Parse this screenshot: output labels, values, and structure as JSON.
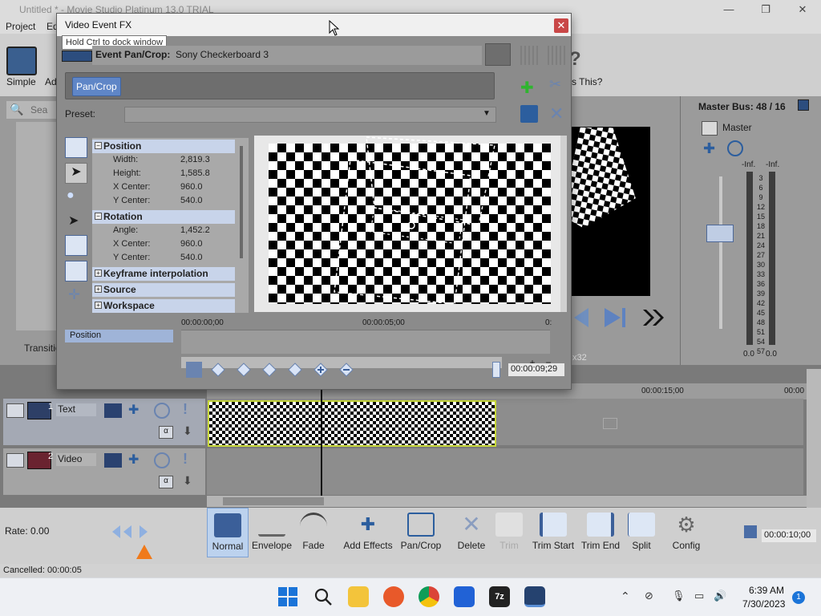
{
  "app": {
    "title": "Untitled * - Movie Studio Platinum 13.0 TRIAL",
    "menu": [
      "Project",
      "Ed"
    ]
  },
  "toolbar": {
    "simple_label": "Simple",
    "advanced_label": "Ad",
    "help_label": "s This?"
  },
  "left_panel": {
    "search_placeholder": "Sea",
    "transitions_tab": "Transitio"
  },
  "master_bus": {
    "title": "Master Bus: 48 / 16",
    "master_label": "Master",
    "peak_left": "-Inf.",
    "peak_right": "-Inf.",
    "scale": [
      "3",
      "6",
      "9",
      "12",
      "15",
      "18",
      "21",
      "24",
      "27",
      "30",
      "33",
      "36",
      "39",
      "42",
      "45",
      "48",
      "51",
      "54",
      "57"
    ],
    "floor_left": "0.0",
    "floor_right": "0.0"
  },
  "preview": {
    "resolution_fragment": "x32"
  },
  "fx_dialog": {
    "title": "Video Event FX",
    "tooltip": "Hold Ctrl to dock window",
    "event_label": "Event Pan/Crop:",
    "event_name": "Sony Checkerboard 3",
    "chain_plugin": "Pan/Crop",
    "preset_label": "Preset:",
    "preset_value": "",
    "sections": {
      "position": "Position",
      "rotation": "Rotation",
      "keyframe": "Keyframe interpolation",
      "source": "Source",
      "workspace": "Workspace"
    },
    "position": {
      "width_label": "Width:",
      "width": "2,819.3",
      "height_label": "Height:",
      "height": "1,585.8",
      "xcenter_label": "X Center:",
      "xcenter": "960.0",
      "ycenter_label": "Y Center:",
      "ycenter": "540.0"
    },
    "rotation": {
      "angle_label": "Angle:",
      "angle": "1,452.2",
      "xcenter_label": "X Center:",
      "xcenter": "960.0",
      "ycenter_label": "Y Center:",
      "ycenter": "540.0"
    },
    "keyframe_track_label": "Position",
    "kf_time_start": "00:00:00;00",
    "kf_time_mid": "00:00:05;00",
    "kf_time_end_frag": "0:",
    "kf_cursor_time": "00:00:09;29"
  },
  "timeline": {
    "ruler_marks": [
      "00:00:15;00",
      "00:00"
    ],
    "tracks": [
      {
        "number": "1",
        "name": "Text"
      },
      {
        "number": "2",
        "name": "Video"
      }
    ]
  },
  "edit_toolbar": {
    "rate_label": "Rate: 0.00",
    "buttons": [
      "Normal",
      "Envelope",
      "Fade",
      "Add Effects",
      "Pan/Crop",
      "Delete",
      "Trim",
      "Trim Start",
      "Trim End",
      "Split",
      "Config"
    ],
    "time_display": "00:00:10;00"
  },
  "status": {
    "text": "Cancelled: 00:00:05"
  },
  "taskbar": {
    "time": "6:39 AM",
    "date": "7/30/2023",
    "notification_count": "1"
  }
}
